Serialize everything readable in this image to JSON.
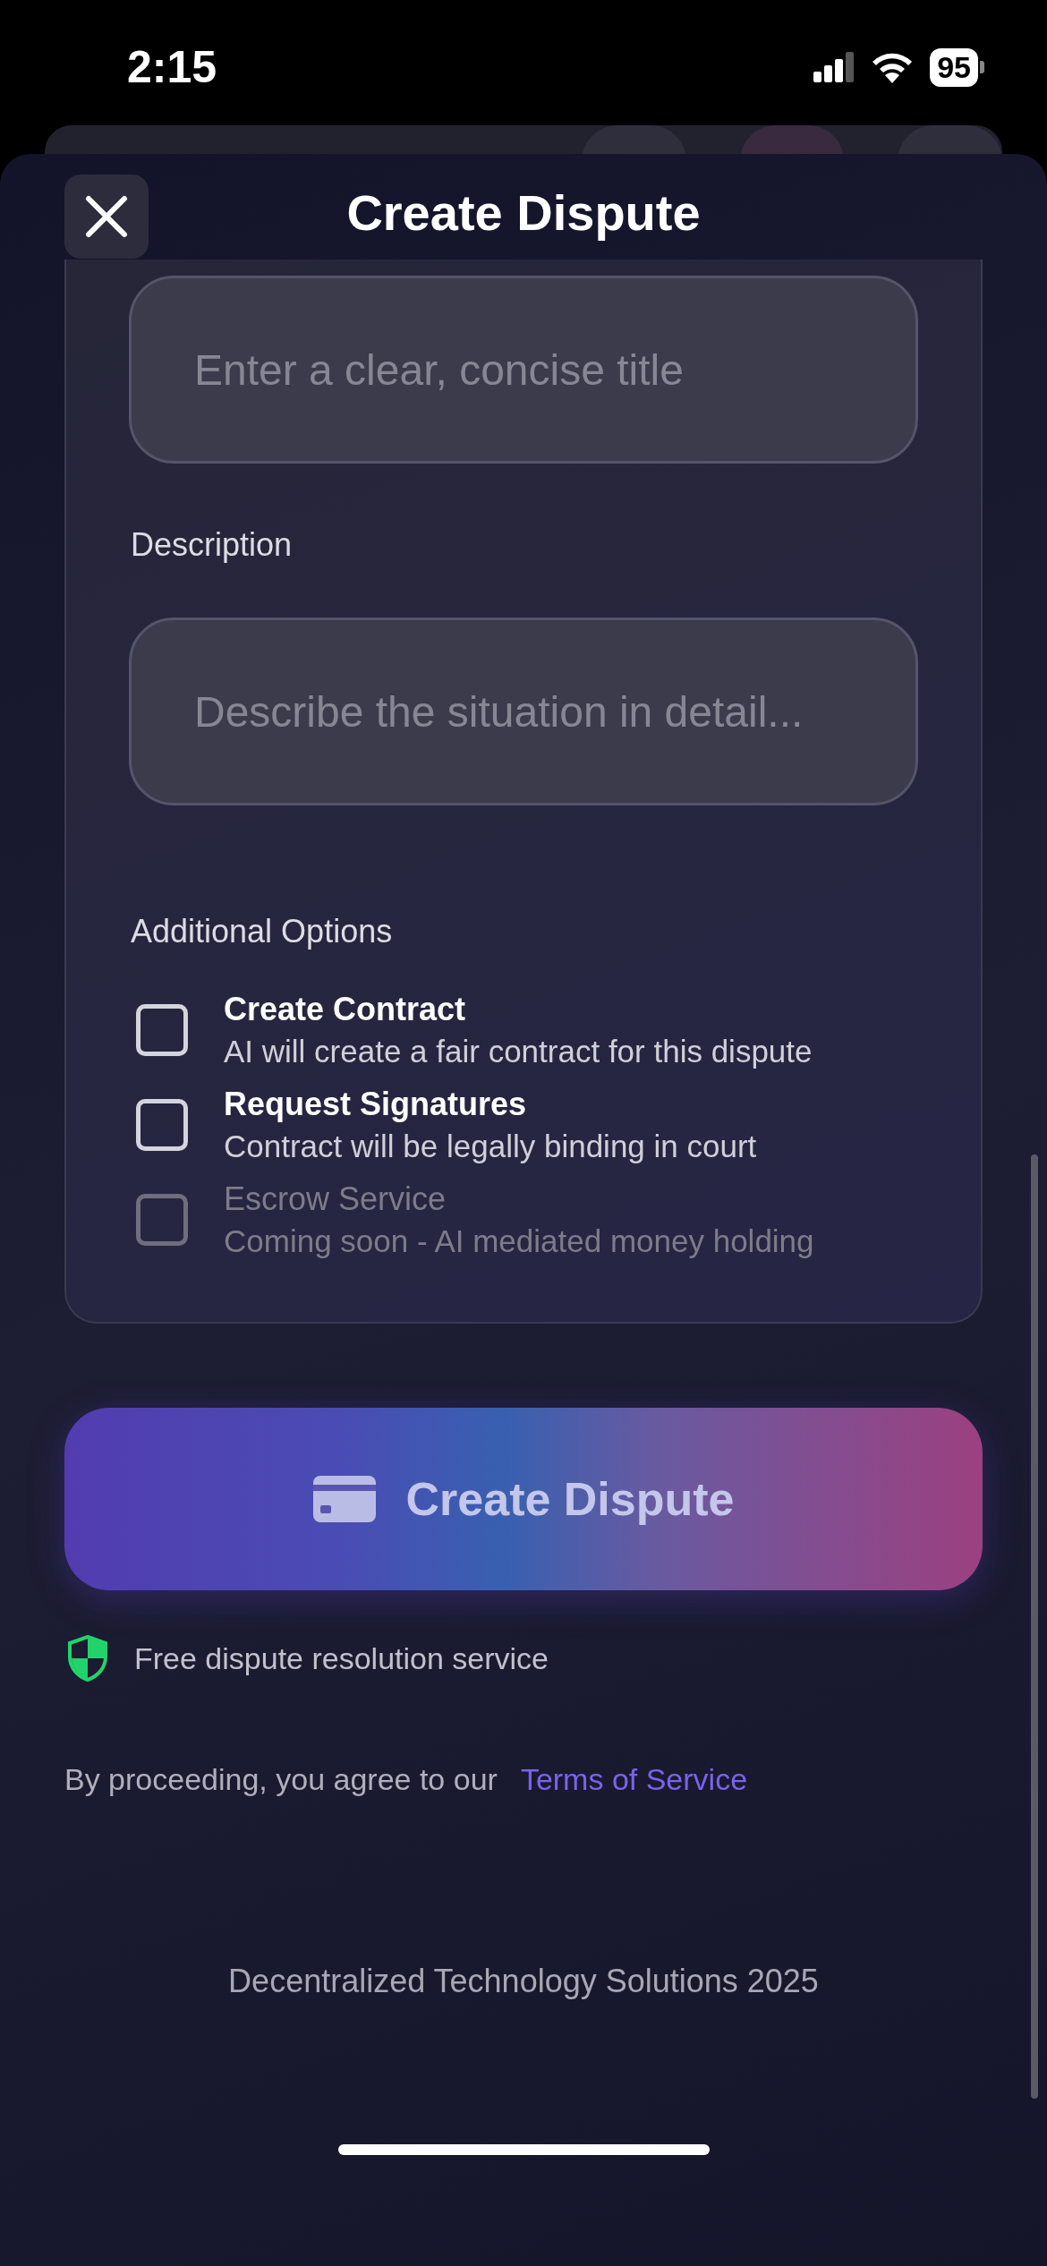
{
  "status_bar": {
    "time": "2:15",
    "battery": "95"
  },
  "header": {
    "title": "Create Dispute"
  },
  "form": {
    "title_field": {
      "placeholder": "Enter a clear, concise title"
    },
    "description": {
      "label": "Description",
      "placeholder": "Describe the situation in detail..."
    },
    "options_label": "Additional Options",
    "options": [
      {
        "title": "Create Contract",
        "subtitle": "AI will create a fair contract for this dispute",
        "checked": false,
        "disabled": false
      },
      {
        "title": "Request Signatures",
        "subtitle": "Contract will be legally binding in court",
        "checked": false,
        "disabled": false
      },
      {
        "title": "Escrow Service",
        "subtitle": "Coming soon - AI mediated money holding",
        "checked": false,
        "disabled": true
      }
    ]
  },
  "submit_button": {
    "label": "Create Dispute"
  },
  "note": "Free dispute resolution service",
  "terms": {
    "text": "By proceeding, you agree to our",
    "link": "Terms of Service"
  },
  "footer": "Decentralized Technology Solutions 2025"
}
